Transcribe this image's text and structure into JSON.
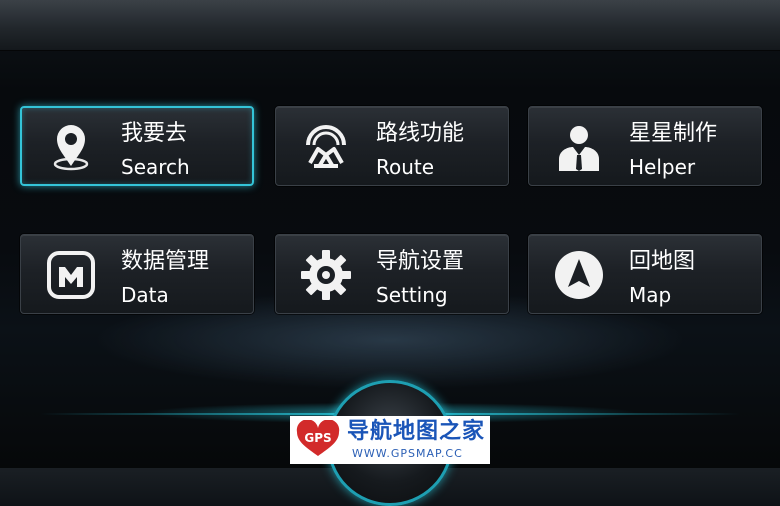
{
  "menu": {
    "items": [
      {
        "label_cn": "我要去",
        "label_en": "Search",
        "icon": "location-pin-icon",
        "selected": true
      },
      {
        "label_cn": "路线功能",
        "label_en": "Route",
        "icon": "route-icon",
        "selected": false
      },
      {
        "label_cn": "星星制作",
        "label_en": "Helper",
        "icon": "person-icon",
        "selected": false
      },
      {
        "label_cn": "数据管理",
        "label_en": "Data",
        "icon": "data-icon",
        "selected": false
      },
      {
        "label_cn": "导航设置",
        "label_en": "Setting",
        "icon": "gear-icon",
        "selected": false
      },
      {
        "label_cn": "回地图",
        "label_en": "Map",
        "icon": "compass-arrow-icon",
        "selected": false
      }
    ]
  },
  "colors": {
    "accent": "#34c4d8",
    "tile_border": "#3a4047",
    "watermark_blue": "#1a55b8",
    "watermark_red": "#d22a2a"
  },
  "watermark": {
    "badge": "GPS",
    "title": "导航地图之家",
    "url": "WWW.GPSMAP.CC"
  }
}
